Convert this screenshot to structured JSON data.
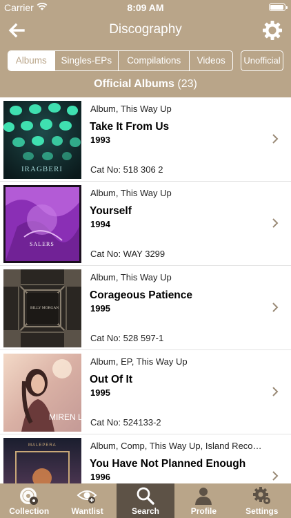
{
  "status_bar": {
    "carrier": "Carrier",
    "time": "8:09 AM"
  },
  "nav": {
    "title": "Discography",
    "back_icon": "arrow-left-icon",
    "settings_icon": "gear-icon"
  },
  "segments": [
    "Albums",
    "Singles-EPs",
    "Compilations",
    "Videos"
  ],
  "active_segment": "Albums",
  "unofficial_label": "Unofficial",
  "section": {
    "title": "Official Albums",
    "count": "(23)"
  },
  "albums": [
    {
      "meta": "Album, This Way Up",
      "title": "Take It From Us",
      "year": "1993",
      "cat": "Cat No: 518 306 2",
      "cover_text": "IRAGBERI"
    },
    {
      "meta": "Album, This Way Up",
      "title": "Yourself",
      "year": "1994",
      "cat": "Cat No: WAY 3299",
      "cover_text": "SALERS"
    },
    {
      "meta": "Album, This Way Up",
      "title": "Corageous Patience",
      "year": "1995",
      "cat": "Cat No: 528 597-1",
      "cover_text": "BILLY MORGAN"
    },
    {
      "meta": "Album, EP, This Way Up",
      "title": "Out Of It",
      "year": "1995",
      "cat": "Cat No: 524133-2",
      "cover_text": "MIREN LEON"
    },
    {
      "meta": "Album, Comp, This Way Up, Island Recor…",
      "title": "You Have Not Planned Enough",
      "year": "1996",
      "cat": "",
      "cover_text": "MALEPERA"
    }
  ],
  "tabs": [
    {
      "label": "Collection",
      "icon": "vinyl-record-icon"
    },
    {
      "label": "Wantlist",
      "icon": "eye-add-icon"
    },
    {
      "label": "Search",
      "icon": "search-icon"
    },
    {
      "label": "Profile",
      "icon": "user-profile-icon"
    },
    {
      "label": "Settings",
      "icon": "gear-settings-icon"
    }
  ],
  "active_tab": "Search",
  "colors": {
    "brand": "#b9a589",
    "active_tab": "#5d5246",
    "chevron": "#9a8a76"
  }
}
